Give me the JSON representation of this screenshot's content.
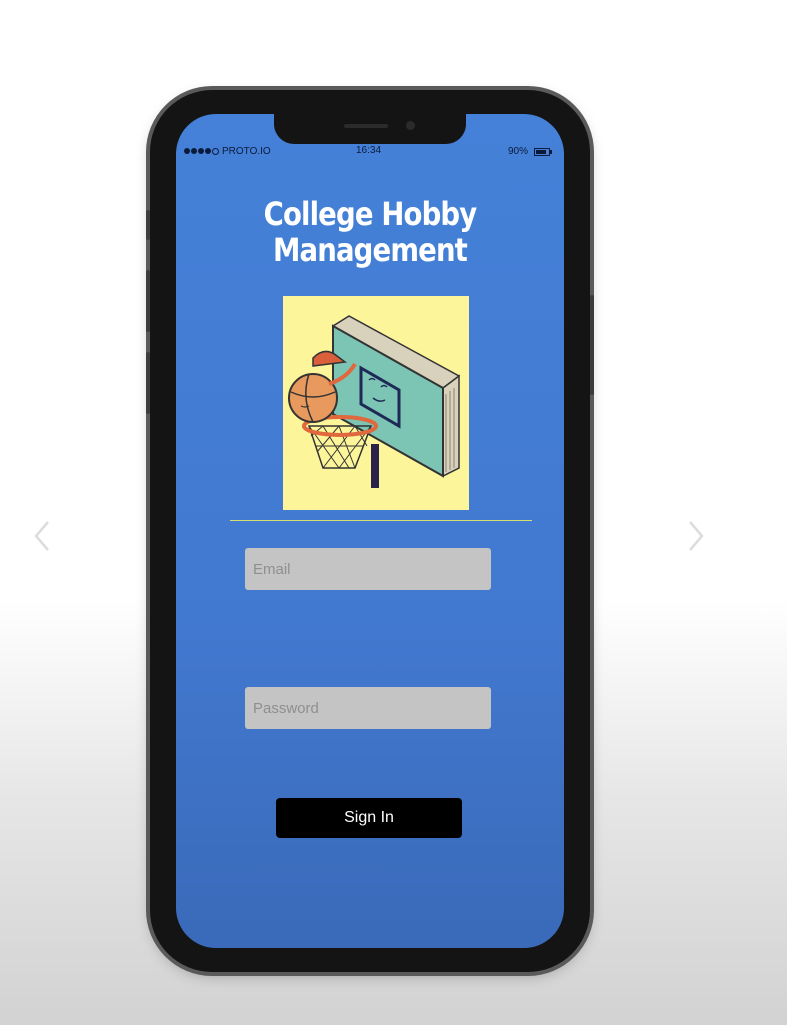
{
  "status_bar": {
    "carrier": "PROTO.IO",
    "time": "16:34",
    "battery": "90%"
  },
  "app": {
    "title_line1": "College Hobby",
    "title_line2": "Management"
  },
  "login": {
    "email_placeholder": "Email",
    "password_placeholder": "Password",
    "signin_label": "Sign In"
  },
  "icons": {
    "prev": "chevron-left-icon",
    "next": "chevron-right-icon",
    "logo": "book-basketball-hoop-logo"
  },
  "colors": {
    "screen_bg": "#4581d8",
    "logo_bg": "#fdf59a",
    "button_bg": "#000000",
    "input_bg": "#c4c4c4"
  }
}
